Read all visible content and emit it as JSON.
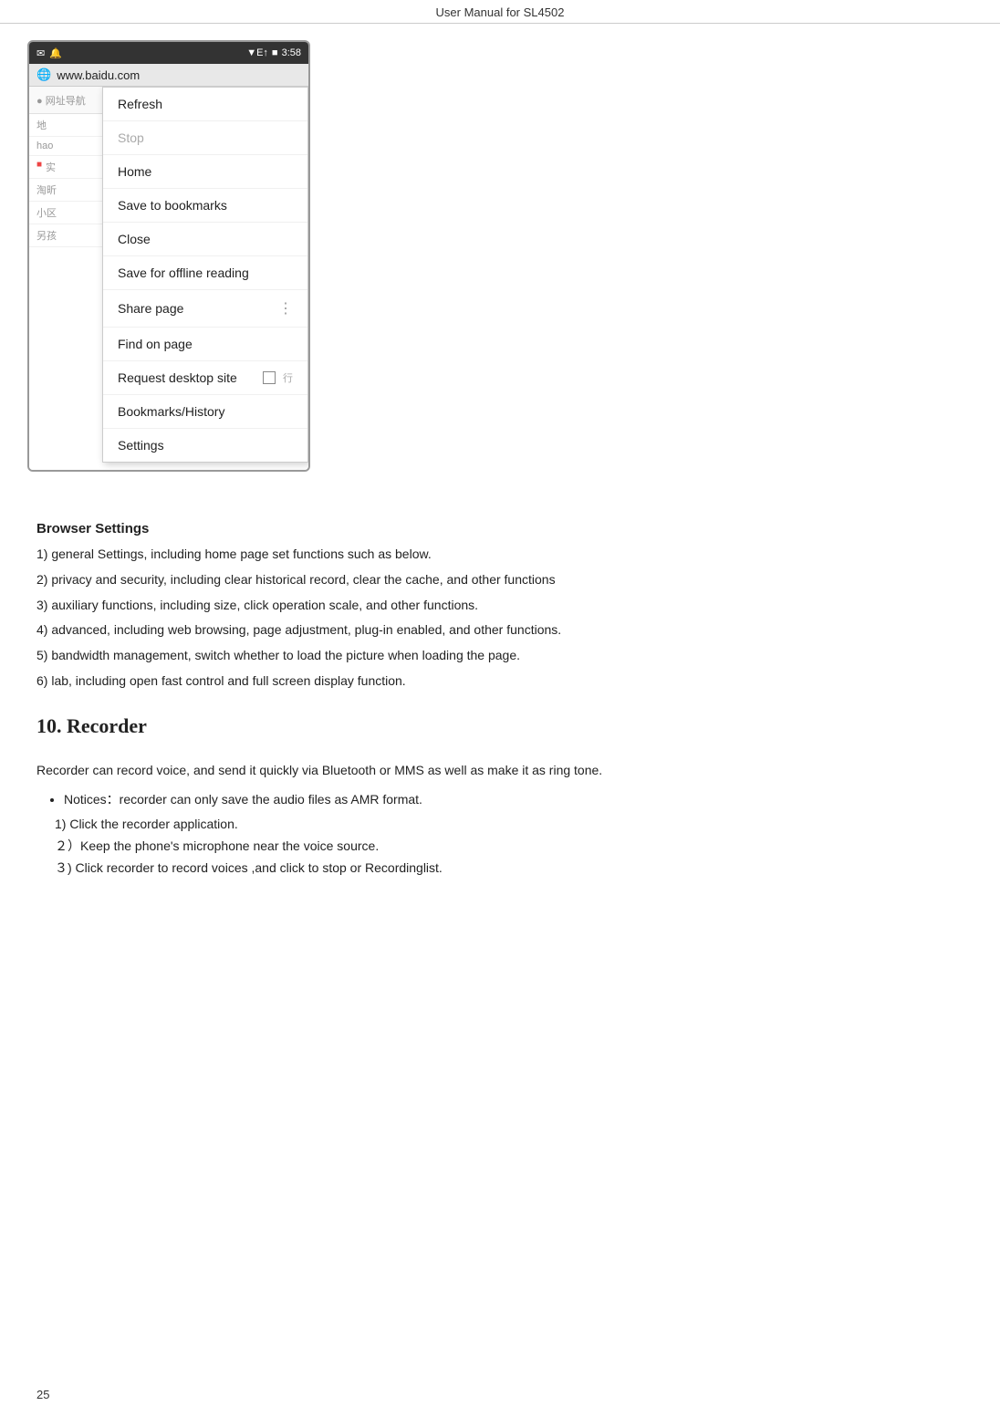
{
  "page": {
    "title": "User Manual for SL4502",
    "page_number": "25"
  },
  "phone": {
    "status_bar": {
      "left_icons": [
        "msg-icon",
        "notification-icon"
      ],
      "signal": "▼E↑",
      "battery": "■",
      "time": "3:58"
    },
    "address_bar": {
      "icon": "🌐",
      "url": "www.baidu.com"
    }
  },
  "dropdown_menu": {
    "items": [
      {
        "id": "refresh",
        "label": "Refresh",
        "disabled": false,
        "has_dots": false,
        "has_checkbox": false
      },
      {
        "id": "stop",
        "label": "Stop",
        "disabled": true,
        "has_dots": false,
        "has_checkbox": false
      },
      {
        "id": "home",
        "label": "Home",
        "disabled": false,
        "has_dots": false,
        "has_checkbox": false
      },
      {
        "id": "save-bookmarks",
        "label": "Save to bookmarks",
        "disabled": false,
        "has_dots": false,
        "has_checkbox": false
      },
      {
        "id": "close",
        "label": "Close",
        "disabled": false,
        "has_dots": false,
        "has_checkbox": false
      },
      {
        "id": "save-offline",
        "label": "Save for offline reading",
        "disabled": false,
        "has_dots": false,
        "has_checkbox": false
      },
      {
        "id": "share-page",
        "label": "Share page",
        "disabled": false,
        "has_dots": true,
        "has_checkbox": false
      },
      {
        "id": "find-on-page",
        "label": "Find on page",
        "disabled": false,
        "has_dots": false,
        "has_checkbox": false
      },
      {
        "id": "request-desktop",
        "label": "Request desktop site",
        "disabled": false,
        "has_dots": false,
        "has_checkbox": true
      },
      {
        "id": "bookmarks-history",
        "label": "Bookmarks/History",
        "disabled": false,
        "has_dots": false,
        "has_checkbox": false
      },
      {
        "id": "settings",
        "label": "Settings",
        "disabled": false,
        "has_dots": false,
        "has_checkbox": false
      }
    ]
  },
  "browser_settings_section": {
    "title": "Browser Settings",
    "items": [
      "1) general Settings, including home page set functions such as below.",
      "2) privacy and security, including clear historical record, clear the cache, and other functions",
      "3) auxiliary functions, including size, click operation scale, and other functions.",
      "4) advanced, including web browsing, page adjustment, plug-in enabled, and other functions.",
      "5) bandwidth management, switch whether to load the picture when loading the page.",
      "6) lab, including open fast control and full screen display function."
    ]
  },
  "recorder_section": {
    "chapter_number": "10.",
    "chapter_title": "Recorder",
    "intro": "Recorder can record voice, and send it quickly via Bluetooth or MMS as well as make it as ring tone.",
    "bullet": "Notices：recorder can only save the audio files as AMR format.",
    "steps": [
      "1) Click the recorder application.",
      "２）Keep the phone's microphone near the voice source.",
      "３) Click recorder to record voices ,and click to stop or Recordinglist."
    ]
  }
}
